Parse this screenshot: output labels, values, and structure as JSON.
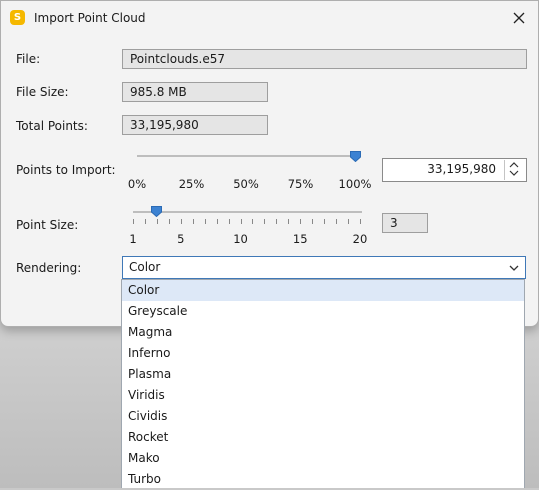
{
  "window": {
    "title": "Import Point Cloud",
    "icon_letter": "S"
  },
  "form": {
    "file_label": "File:",
    "file_value": "Pointclouds.e57",
    "file_size_label": "File Size:",
    "file_size_value": "985.8 MB",
    "total_points_label": "Total Points:",
    "total_points_value": "33,195,980",
    "points_import_label": "Points to Import:",
    "points_import_value": "33,195,980",
    "points_import_fraction": 1.0,
    "points_import_ticks": [
      "0%",
      "25%",
      "50%",
      "75%",
      "100%"
    ],
    "point_size_label": "Point Size:",
    "point_size_value": "3",
    "point_size_min": 1,
    "point_size_max": 20,
    "point_size_current": 3,
    "point_size_ticks": [
      "1",
      "5",
      "10",
      "15",
      "20"
    ],
    "rendering_label": "Rendering:",
    "rendering_value": "Color"
  },
  "dropdown": {
    "options": [
      "Color",
      "Greyscale",
      "Magma",
      "Inferno",
      "Plasma",
      "Viridis",
      "Cividis",
      "Rocket",
      "Mako",
      "Turbo"
    ],
    "selected_index": 0
  }
}
